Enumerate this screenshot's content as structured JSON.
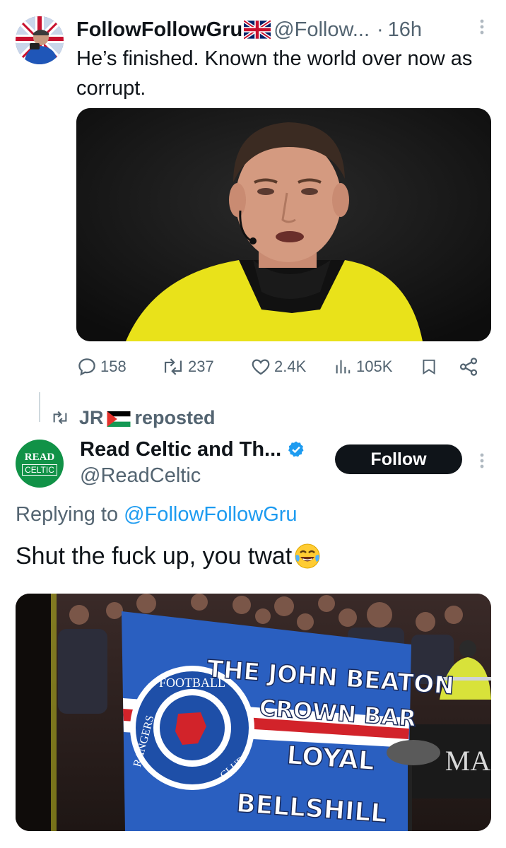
{
  "tweet1": {
    "display_name": "FollowFollowGru",
    "name_flag_icon": "uk-flag-icon",
    "handle": "@Follow...",
    "separator": "·",
    "time": "16h",
    "text": "He’s finished. Known the world over now as corrupt.",
    "image_icon": "referee-photo",
    "actions": {
      "replies": "158",
      "reposts": "237",
      "likes": "2.4K",
      "views": "105K"
    }
  },
  "repost_context": {
    "user": "JR",
    "flag_icon": "palestine-flag-icon",
    "label": "reposted"
  },
  "tweet2": {
    "display_name": "Read Celtic and Th...",
    "handle": "@ReadCeltic",
    "avatar_top": "READ",
    "avatar_bottom": "CELTIC",
    "follow_label": "Follow",
    "replying_prefix": "Replying to",
    "replying_to": "@FollowFollowGru",
    "text": "Shut the fuck up, you twat",
    "emoji_icon": "laughing-tears-emoji",
    "image": {
      "banner_line1": "THE JOHN BEATON",
      "banner_line2": "CROWN BAR",
      "banner_line3": "LOYAL",
      "banner_line4": "BELLSHILL",
      "crest_text_top": "FOOTBALL",
      "crest_text_left": "RANGERS",
      "crest_text_right": "CLUB",
      "board_text": "MA"
    }
  },
  "colors": {
    "link": "#1d9bf0",
    "muted": "#536471",
    "follow_bg": "#0f1419",
    "verified": "#1d9bf0",
    "avatar2_bg": "#119247",
    "referee_shirt": "#e9e21a"
  }
}
